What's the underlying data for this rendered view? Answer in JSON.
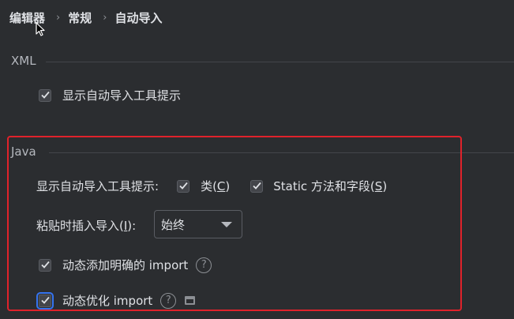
{
  "breadcrumb": {
    "items": [
      "编辑器",
      "常规",
      "自动导入"
    ],
    "separator": "›"
  },
  "xml_section": {
    "title": "XML",
    "show_tooltip_label": "显示自动导入工具提示",
    "show_tooltip_checked": true
  },
  "java_section": {
    "title": "Java",
    "show_tooltip_label": "显示自动导入工具提示:",
    "class_option": {
      "label": "类(",
      "mnemonic": "C",
      "suffix": ")",
      "checked": true
    },
    "static_option": {
      "label": "Static 方法和字段(",
      "mnemonic": "S",
      "suffix": ")",
      "checked": true
    },
    "paste_insert": {
      "label": "粘贴时插入导入(",
      "mnemonic": "I",
      "suffix": "):",
      "selected": "始终"
    },
    "add_unambiguous": {
      "label": "动态添加明确的 import",
      "checked": true
    },
    "optimize_imports": {
      "label": "动态优化 import",
      "checked": true
    }
  },
  "colors": {
    "background": "#2b2d30",
    "highlight_border": "#e0222b",
    "focus_ring": "#3574f0"
  },
  "icons": [
    "cursor-icon",
    "check-icon",
    "help-icon",
    "window-icon",
    "chevron-down-icon"
  ]
}
